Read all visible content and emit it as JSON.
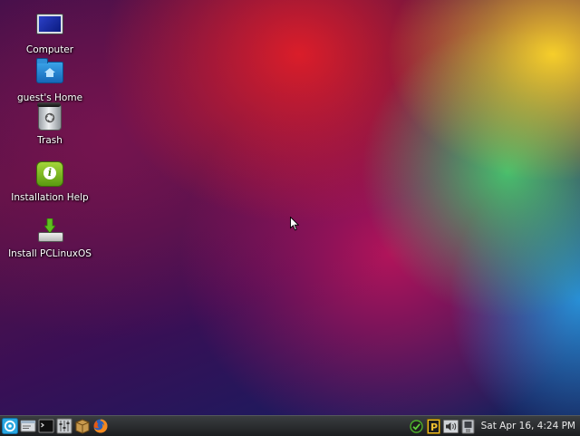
{
  "desktop": {
    "icons": [
      {
        "label": "Computer"
      },
      {
        "label": "guest's Home"
      },
      {
        "label": "Trash"
      },
      {
        "label": "Installation Help"
      },
      {
        "label": "Install PCLinuxOS"
      }
    ]
  },
  "taskbar": {
    "clock": "Sat Apr 16,  4:24 PM",
    "launchers": [
      "menu-icon",
      "file-manager-icon",
      "terminal-icon",
      "mixer-icon",
      "package-icon",
      "firefox-icon"
    ],
    "tray": [
      "update-check-icon",
      "pclinuxos-p-icon",
      "volume-icon",
      "network-icon"
    ]
  },
  "colors": {
    "taskbar": "#26282a",
    "accent": "#2aa7e0"
  }
}
